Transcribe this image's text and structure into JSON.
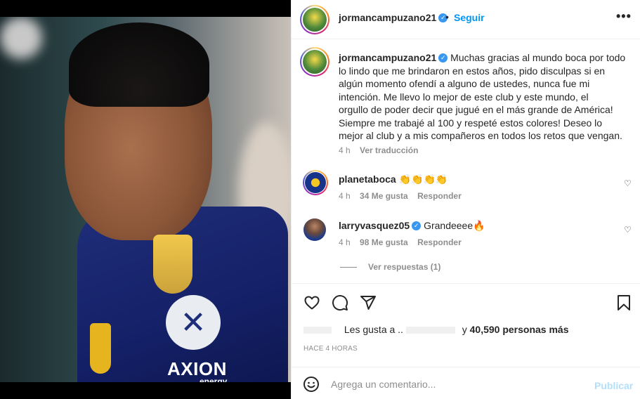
{
  "post": {
    "author": "jormancampuzano21",
    "follow_label": "Seguir",
    "separator": "•",
    "more_label": "•••",
    "caption_author": "jormancampuzano21",
    "caption_lines": [
      "Muchas gracias al mundo boca por todo",
      "lo lindo que me brindaron en estos años, pido disculpas si en",
      "algún momento ofendí a alguno de ustedes, nunca fue mi",
      "intención. Me llevo lo mejor de este club y este mundo, el",
      "orgullo de poder decir que jugué en el más grande de América!",
      "Siempre me trabajé al 100 y respeté estos colores! Deseo lo",
      "mejor al club y a mis compañeros en todos los retos que vengan."
    ],
    "caption_time": "4 h",
    "translate_label": "Ver traducción",
    "photo": {
      "sponsor": "AXION",
      "sponsor_sub": "energy",
      "sponsor_symbol": "✕"
    }
  },
  "comments": [
    {
      "user": "planetaboca",
      "verified": false,
      "text": "👏👏👏👏",
      "time": "4 h",
      "likes": "34 Me gusta",
      "reply_label": "Responder"
    },
    {
      "user": "larryvasquez05",
      "verified": true,
      "text": "Grandeeee🔥",
      "time": "4 h",
      "likes": "98 Me gusta",
      "reply_label": "Responder"
    }
  ],
  "view_replies": "Ver respuestas (1)",
  "likes": {
    "prefix": "Les gusta a",
    "dots": "..",
    "suffix_y": "y",
    "count": "40,590 personas más"
  },
  "time_ago": "HACE 4 HORAS",
  "comment_input": {
    "placeholder": "Agrega un comentario...",
    "publish_label": "Publicar"
  },
  "icons": {
    "like": "heart-icon",
    "comment": "comment-icon",
    "share": "share-icon",
    "save": "bookmark-icon",
    "emoji": "emoji-icon",
    "verified": "verified-badge-icon"
  },
  "colors": {
    "link": "#0095f6",
    "muted": "#8e8e8e",
    "verified": "#3897f0",
    "publish_disabled": "#b2dffc"
  }
}
